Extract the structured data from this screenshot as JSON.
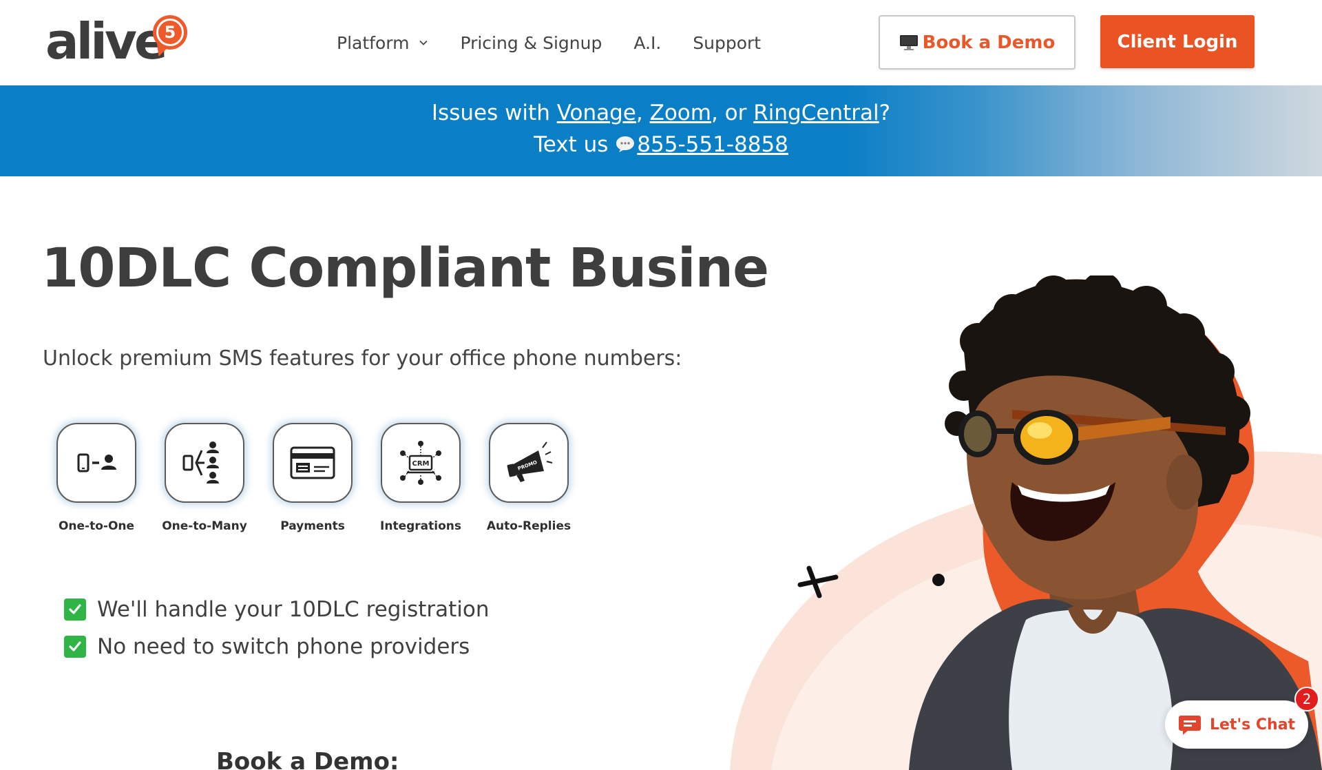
{
  "header": {
    "logo_text": "alive",
    "logo_badge": "5",
    "nav": [
      {
        "label": "Platform",
        "has_dropdown": true
      },
      {
        "label": "Pricing & Signup"
      },
      {
        "label": "A.I."
      },
      {
        "label": "Support"
      }
    ],
    "demo_button": "Book a Demo",
    "login_button": "Client Login"
  },
  "banner": {
    "prefix": "Issues with ",
    "vonage": "Vonage",
    "sep1": ", ",
    "zoom": "Zoom",
    "sep2": ", or ",
    "ringcentral": "RingCentral",
    "suffix": "?",
    "text_us": "Text us ",
    "phone": "855-551-8858"
  },
  "hero": {
    "headline": "10DLC Compliant Busine",
    "subline": "Unlock premium SMS features for your office phone numbers:",
    "features": [
      {
        "label": "One-to-One",
        "icon": "phone-to-person-icon"
      },
      {
        "label": "One-to-Many",
        "icon": "phone-to-group-icon"
      },
      {
        "label": "Payments",
        "icon": "credit-card-icon"
      },
      {
        "label": "Integrations",
        "icon": "crm-network-icon",
        "icon_text": "CRM"
      },
      {
        "label": "Auto-Replies",
        "icon": "promo-megaphone-icon",
        "icon_text": "PROMO"
      }
    ],
    "checklist": [
      "We'll handle your 10DLC registration",
      "No need to switch phone providers"
    ],
    "book_heading": "Book a Demo:"
  },
  "chat": {
    "label": "Let's Chat",
    "badge_count": "2"
  },
  "colors": {
    "brand_orange": "#ea5424",
    "banner_blue": "#0b7fc6",
    "check_green": "#2fb546",
    "heading_gray": "#3e3e3e"
  }
}
